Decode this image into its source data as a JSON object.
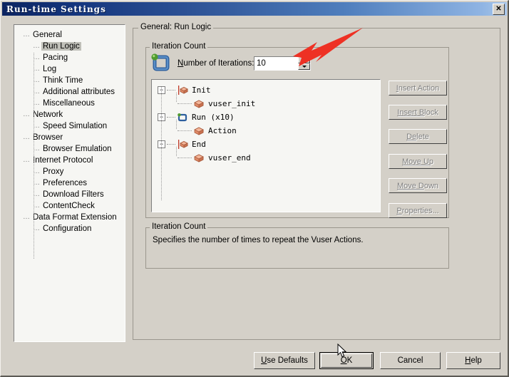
{
  "window": {
    "title": "Run-time Settings",
    "close_label": "✕"
  },
  "sidebar": {
    "items": [
      {
        "label": "General",
        "level": 0,
        "selected": false
      },
      {
        "label": "Run Logic",
        "level": 1,
        "selected": true
      },
      {
        "label": "Pacing",
        "level": 1,
        "selected": false
      },
      {
        "label": "Log",
        "level": 1,
        "selected": false
      },
      {
        "label": "Think Time",
        "level": 1,
        "selected": false
      },
      {
        "label": "Additional attributes",
        "level": 1,
        "selected": false
      },
      {
        "label": "Miscellaneous",
        "level": 1,
        "selected": false
      },
      {
        "label": "Network",
        "level": 0,
        "selected": false
      },
      {
        "label": "Speed Simulation",
        "level": 1,
        "selected": false
      },
      {
        "label": "Browser",
        "level": 0,
        "selected": false
      },
      {
        "label": "Browser Emulation",
        "level": 1,
        "selected": false
      },
      {
        "label": "Internet Protocol",
        "level": 0,
        "selected": false
      },
      {
        "label": "Proxy",
        "level": 1,
        "selected": false
      },
      {
        "label": "Preferences",
        "level": 1,
        "selected": false
      },
      {
        "label": "Download Filters",
        "level": 1,
        "selected": false
      },
      {
        "label": "ContentCheck",
        "level": 1,
        "selected": false
      },
      {
        "label": "Data Format Extension",
        "level": 0,
        "selected": false
      },
      {
        "label": "Configuration",
        "level": 1,
        "selected": false
      }
    ]
  },
  "main": {
    "outer_group_legend": "General: Run Logic",
    "iteration_group_legend": "Iteration Count",
    "iterations_label_prefix": "N",
    "iterations_label_rest": "umber of Iterations:",
    "iterations_value": "10",
    "loop_icon_name": "iteration-loop-icon",
    "spinner_up": "spin-up-icon",
    "spinner_down": "spin-down-icon",
    "actions": [
      {
        "label": "Init",
        "level": 0,
        "icon": "init-block-icon",
        "expander": "−"
      },
      {
        "label": "vuser_init",
        "level": 1,
        "icon": "action-block-icon",
        "expander": ""
      },
      {
        "label": "Run  (x10)",
        "level": 0,
        "icon": "run-loop-icon",
        "expander": "−"
      },
      {
        "label": "Action",
        "level": 1,
        "icon": "action-block-icon",
        "expander": ""
      },
      {
        "label": "End",
        "level": 0,
        "icon": "end-block-icon",
        "expander": "−"
      },
      {
        "label": "vuser_end",
        "level": 1,
        "icon": "action-block-icon",
        "expander": ""
      }
    ],
    "side_buttons": [
      {
        "pre": "I",
        "post": "nsert Action",
        "name": "insert-action-button",
        "disabled": true
      },
      {
        "pre": "Insert B",
        "post": "lock",
        "name": "insert-block-button",
        "disabled": true
      },
      {
        "pre": "De",
        "post": "lete",
        "name": "delete-button",
        "disabled": true
      },
      {
        "pre": "Move U",
        "post": "p",
        "name": "move-up-button",
        "disabled": true
      },
      {
        "pre": "Move D",
        "post": "own",
        "name": "move-down-button",
        "disabled": true
      },
      {
        "pre": "P",
        "post": "roperties...",
        "name": "properties-button",
        "disabled": true
      }
    ],
    "description_group_legend": "Iteration Count",
    "description_text": "Specifies the number of times to repeat the Vuser Actions."
  },
  "footer": {
    "buttons": [
      {
        "pre": "U",
        "post": "se Defaults",
        "name": "use-defaults-button",
        "default": false
      },
      {
        "pre": "O",
        "post": "K",
        "name": "ok-button",
        "default": true
      },
      {
        "pre": "",
        "post": "Cancel",
        "name": "cancel-button",
        "default": false
      },
      {
        "pre": "H",
        "post": "elp",
        "name": "help-button",
        "default": false
      }
    ]
  },
  "annotation": {
    "arrow_color": "#ee3124",
    "arrow_name": "red-annotation-arrow"
  },
  "colors": {
    "dialog_face": "#d4d0c8",
    "field_bg": "#f6f6f3",
    "title_dark": "#0c2461",
    "title_light": "#a8c6ea",
    "selection": "#bfbfb8"
  }
}
